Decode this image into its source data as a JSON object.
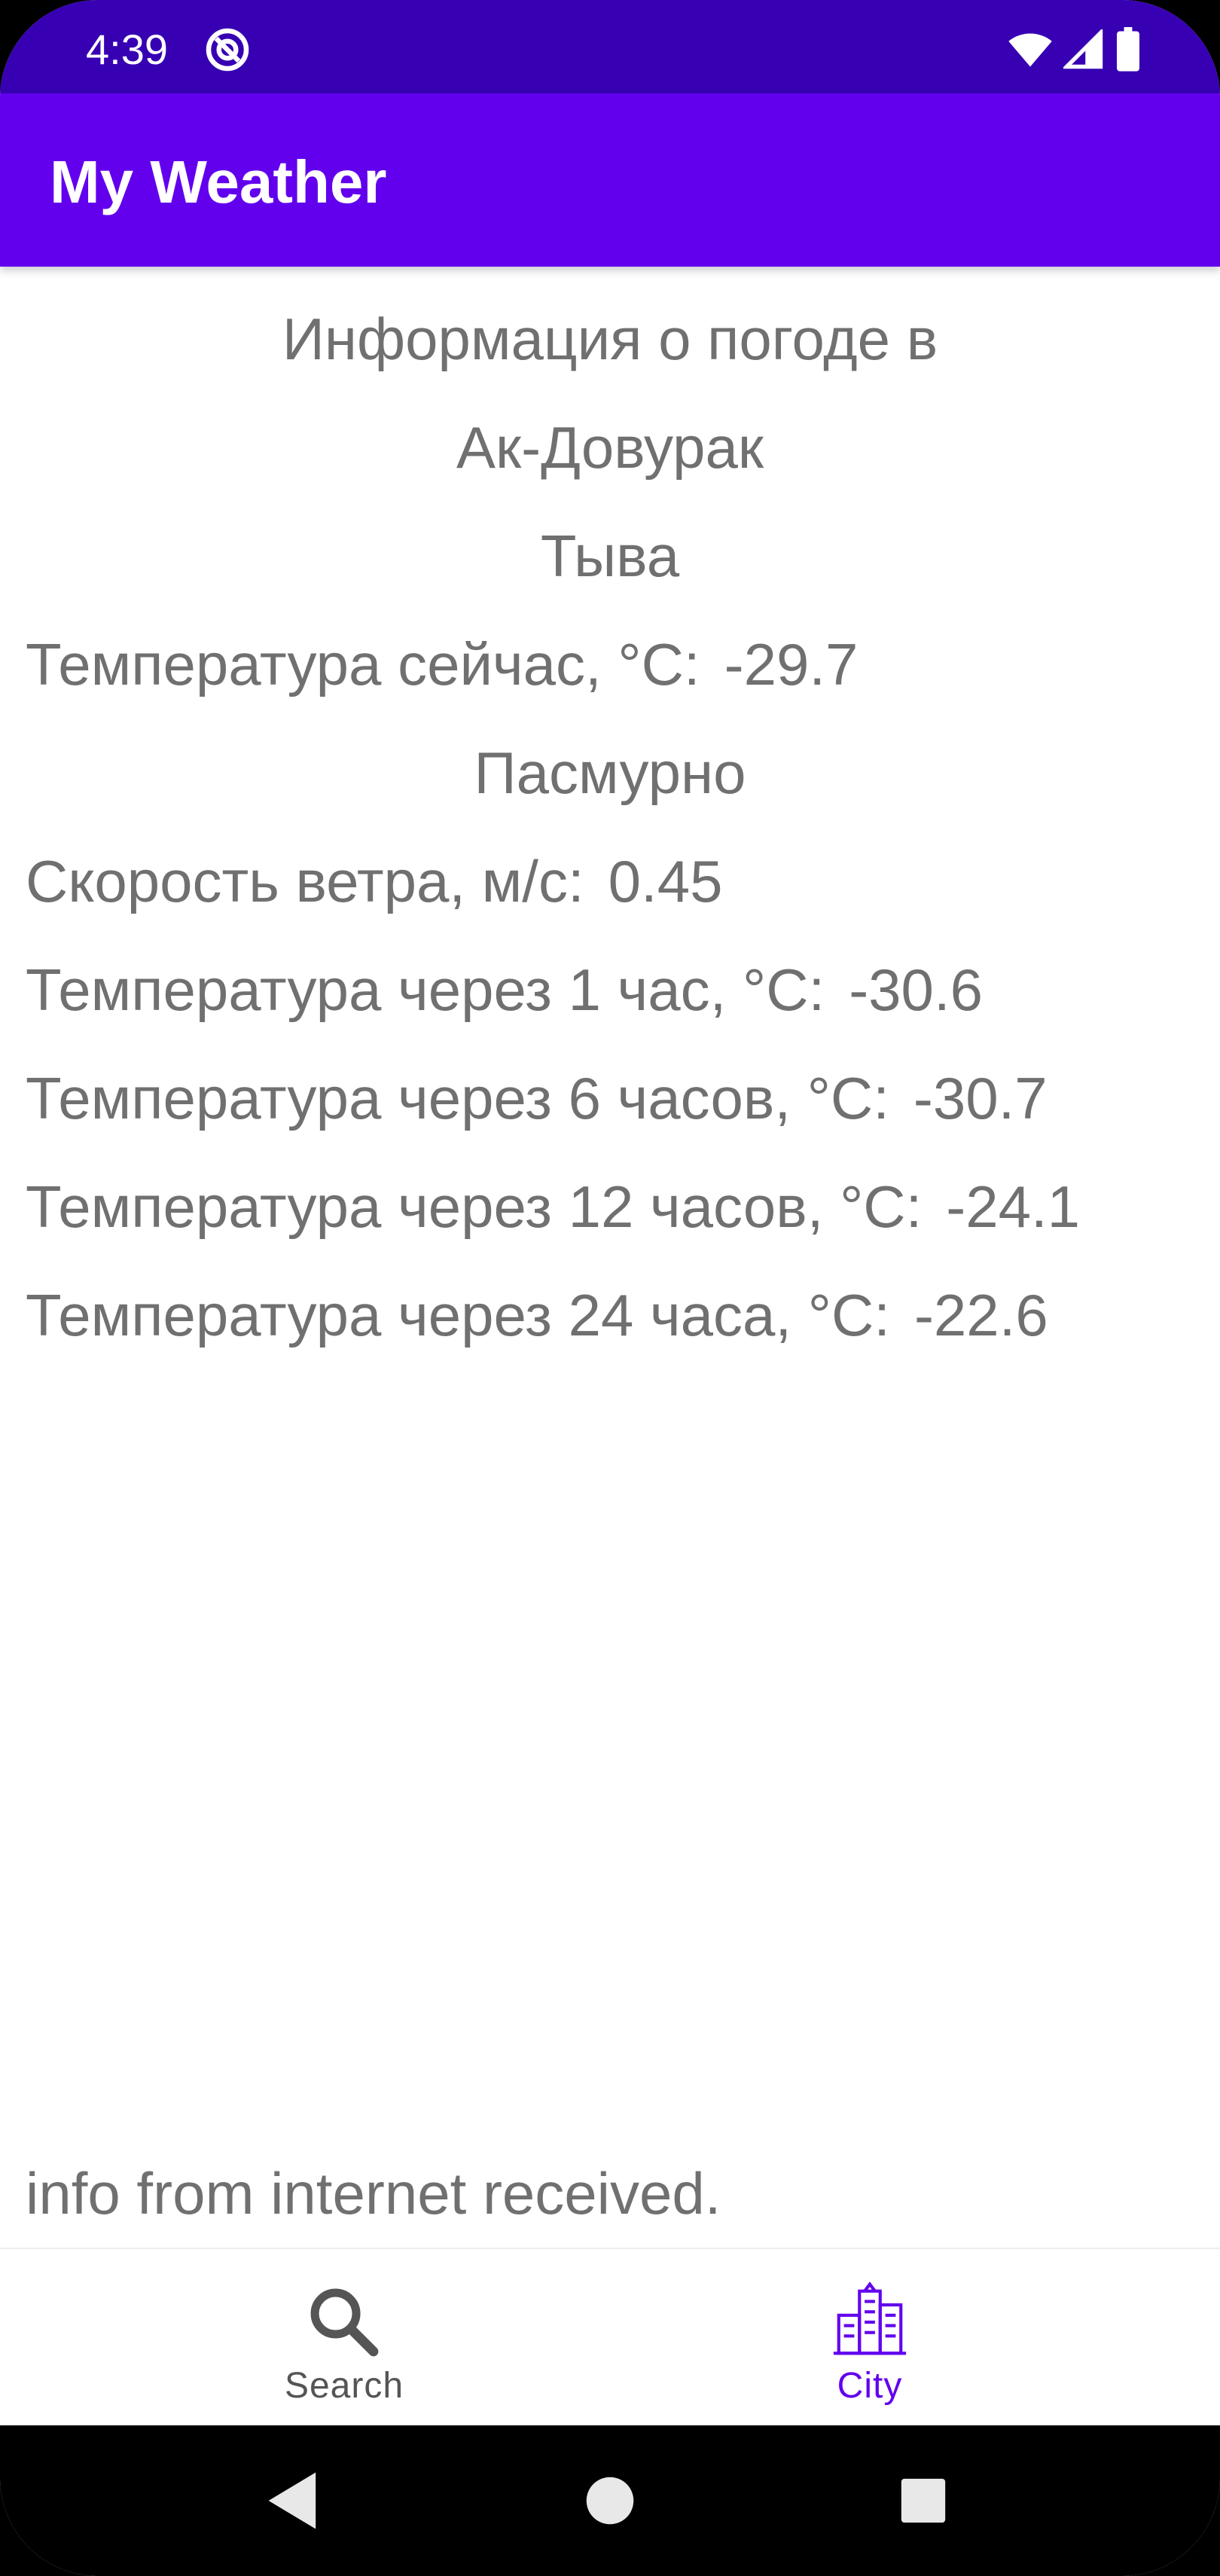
{
  "status_bar": {
    "time": "4:39",
    "icons": [
      "app-status-icon",
      "wifi-icon",
      "signal-icon",
      "battery-icon"
    ]
  },
  "app_bar": {
    "title": "My Weather"
  },
  "weather": {
    "header": "Информация о погоде в",
    "city": "Ак-Довурак",
    "region": "Тыва",
    "current_temp": {
      "label": "Температура сейчас, °C:",
      "value": "-29.7"
    },
    "condition": "Пасмурно",
    "wind_speed": {
      "label": "Скорость ветра, м/с:",
      "value": "0.45"
    },
    "forecast": [
      {
        "label": "Температура через 1 час, °C:",
        "value": "-30.6"
      },
      {
        "label": "Температура через 6 часов, °C:",
        "value": "-30.7"
      },
      {
        "label": "Температура через 12 часов, °C:",
        "value": "-24.1"
      },
      {
        "label": "Температура через 24 часа, °C:",
        "value": "-22.6"
      }
    ]
  },
  "status_message": "info from internet received.",
  "bottom_nav": {
    "items": [
      {
        "label": "Search",
        "icon": "search-icon",
        "active": false
      },
      {
        "label": "City",
        "icon": "city-icon",
        "active": true
      }
    ]
  },
  "colors": {
    "status_bar": "#3700b3",
    "app_bar": "#6200ee",
    "text": "#707070",
    "nav_active": "#6200ee",
    "nav_inactive": "#555555"
  },
  "system_nav": {
    "buttons": [
      "back-icon",
      "home-icon",
      "recents-icon"
    ]
  }
}
